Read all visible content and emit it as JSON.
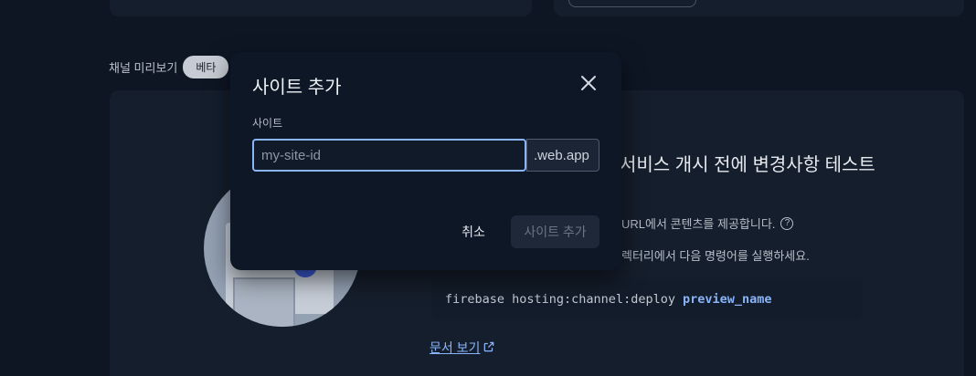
{
  "section": {
    "label": "채널 미리보기",
    "badge": "베타"
  },
  "preview": {
    "heading": "서비스 개시 전에 변경사항 테스트",
    "desc_1": "URL에서 콘텐츠를 제공합니다.",
    "desc_2": "렉터리에서 다음 명령어를 실행하세요.",
    "code_command": "firebase hosting:channel:deploy",
    "code_argument": "preview_name",
    "docs_link": "문서 보기",
    "help_icon_glyph": "?"
  },
  "dialog": {
    "title": "사이트 추가",
    "field_label": "사이트",
    "input_value": "",
    "input_placeholder": "my-site-id",
    "suffix": ".web.app",
    "cancel_label": "취소",
    "submit_label": "사이트 추가"
  },
  "icons": {
    "close": "close-icon",
    "help": "help-circle-icon",
    "external": "open-in-new-icon"
  },
  "colors": {
    "background": "#0e1624",
    "card": "#151e2c",
    "dialog": "#0d1726",
    "accent": "#8ab4f8",
    "illustration_dot": "#3c5bd6"
  }
}
